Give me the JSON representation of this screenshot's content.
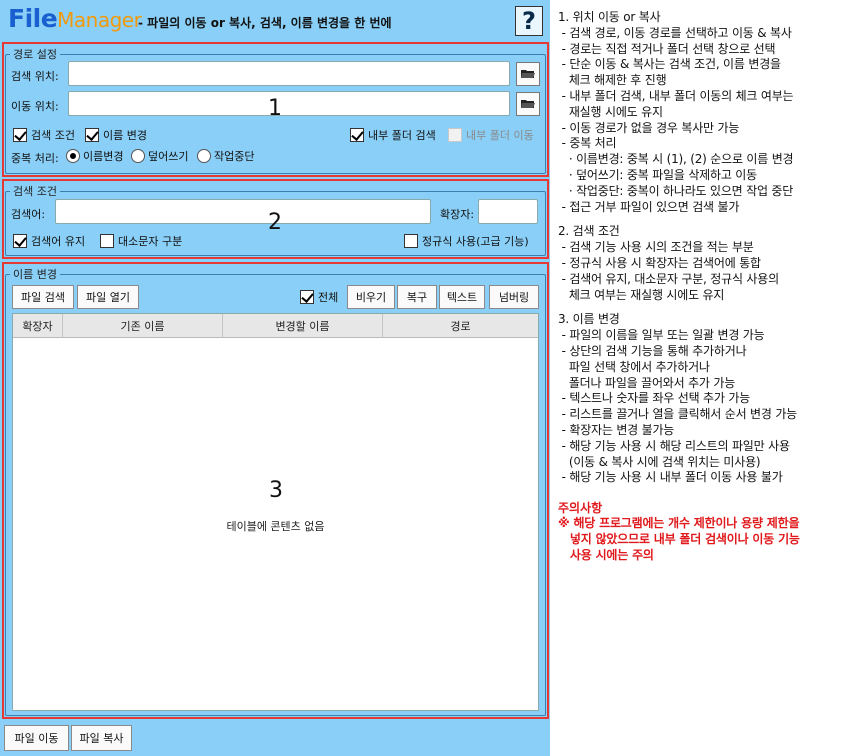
{
  "app": {
    "logo_file": "File",
    "logo_manager": "Manager",
    "subtitle": "- 파일의 이동 or 복사, 검색, 이름 변경을 한 번에",
    "help_label": "?"
  },
  "path_settings": {
    "legend": "경로 설정",
    "search_location_label": "검색 위치:",
    "search_location_value": "",
    "move_location_label": "이동 위치:",
    "move_location_value": "",
    "section_number": "1",
    "search_condition_label": "검색 조건",
    "search_condition_checked": true,
    "rename_label": "이름 변경",
    "rename_checked": true,
    "inner_folder_search_label": "내부 폴더 검색",
    "inner_folder_search_checked": true,
    "inner_folder_move_label": "내부 폴더 이동",
    "inner_folder_move_checked": false,
    "duplicate_label": "중복 처리:",
    "duplicate_options": [
      "이름변경",
      "덮어쓰기",
      "작업중단"
    ],
    "duplicate_selected": "이름변경"
  },
  "search_conditions": {
    "legend": "검색 조건",
    "query_label": "검색어:",
    "query_value": "",
    "extension_label": "확장자:",
    "extension_value": "",
    "section_number": "2",
    "keep_query_label": "검색어 유지",
    "keep_query_checked": true,
    "case_sensitive_label": "대소문자 구분",
    "case_sensitive_checked": false,
    "regex_label": "정규식 사용(고급 기능)",
    "regex_checked": false
  },
  "rename": {
    "legend": "이름 변경",
    "file_search_label": "파일 검색",
    "file_open_label": "파일 열기",
    "all_label": "전체",
    "all_checked": true,
    "clear_label": "비우기",
    "restore_label": "복구",
    "text_label": "텍스트",
    "numbering_label": "넘버링",
    "columns": [
      "확장자",
      "기존 이름",
      "변경할 이름",
      "경로"
    ],
    "section_number": "3",
    "empty_text": "테이블에 콘텐츠 없음"
  },
  "bottom": {
    "move_label": "파일 이동",
    "copy_label": "파일 복사"
  },
  "instructions": {
    "lines": [
      "1. 위치 이동 or 복사",
      " - 검색 경로, 이동 경로를 선택하고 이동 & 복사",
      " - 경로는 직접 적거나 폴더 선택 창으로 선택",
      " - 단순 이동 & 복사는 검색 조건, 이름 변경을",
      "   체크 해제한 후 진행",
      " - 내부 폴더 검색, 내부 폴더 이동의 체크 여부는",
      "   재실행 시에도 유지",
      " - 이동 경로가 없을 경우 복사만 가능",
      " - 중복 처리",
      "   · 이름변경: 중복 시 (1), (2) 순으로 이름 변경",
      "   · 덮어쓰기: 중복 파일을 삭제하고 이동",
      "   · 작업중단: 중복이 하나라도 있으면 작업 중단",
      " - 접근 거부 파일이 있으면 검색 불가",
      "",
      "2. 검색 조건",
      " - 검색 기능 사용 시의 조건을 적는 부분",
      " - 정규식 사용 시 확장자는 검색어에 통합",
      " - 검색어 유지, 대소문자 구분, 정규식 사용의",
      "   체크 여부는 재실행 시에도 유지",
      "",
      "3. 이름 변경",
      " - 파일의 이름을 일부 또는 일괄 변경 가능",
      " - 상단의 검색 기능을 통해 추가하거나",
      "   파일 선택 창에서 추가하거나",
      "   폴더나 파일을 끌어와서 추가 가능",
      " - 텍스트나 숫자를 좌우 선택 추가 가능",
      " - 리스트를 끌거나 열을 클릭해서 순서 변경 가능",
      " - 확장자는 변경 불가능",
      " - 해당 기능 사용 시 해당 리스트의 파일만 사용",
      "   (이동 & 복사 시에 검색 위치는 미사용)",
      " - 해당 기능 사용 시 내부 폴더 이동 사용 불가"
    ],
    "warning_title": "주의사항",
    "warning_lines": [
      "※ 해당 프로그램에는 개수 제한이나 용량 제한을",
      "   넣지 않았으므로 내부 폴더 검색이나 이동 기능",
      "   사용 시에는 주의"
    ]
  },
  "colors": {
    "panel_bg": "#89cff7",
    "highlight_border": "#e53935",
    "logo_blue": "#1a5fd0",
    "logo_orange": "#f29a0e",
    "warning_red": "#e0191c"
  }
}
